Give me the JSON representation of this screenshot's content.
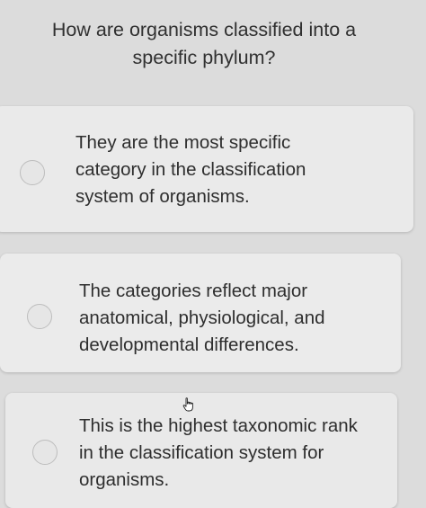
{
  "question": {
    "text": "How are organisms classified into a specific phylum?"
  },
  "options": [
    {
      "label": "They are the most specific\ncategory in the classification\nsystem of organisms."
    },
    {
      "label": "The categories reflect major\nanatomical, physiological, and\ndevelopmental differences."
    },
    {
      "label": "This is the highest taxonomic rank\nin the classification system for\norganisms."
    }
  ],
  "colors": {
    "page_background": "#dcdcdc",
    "card_background": "#ececec",
    "text": "#2e2e2e"
  },
  "icons": {
    "cursor": "hand-pointer-icon"
  }
}
